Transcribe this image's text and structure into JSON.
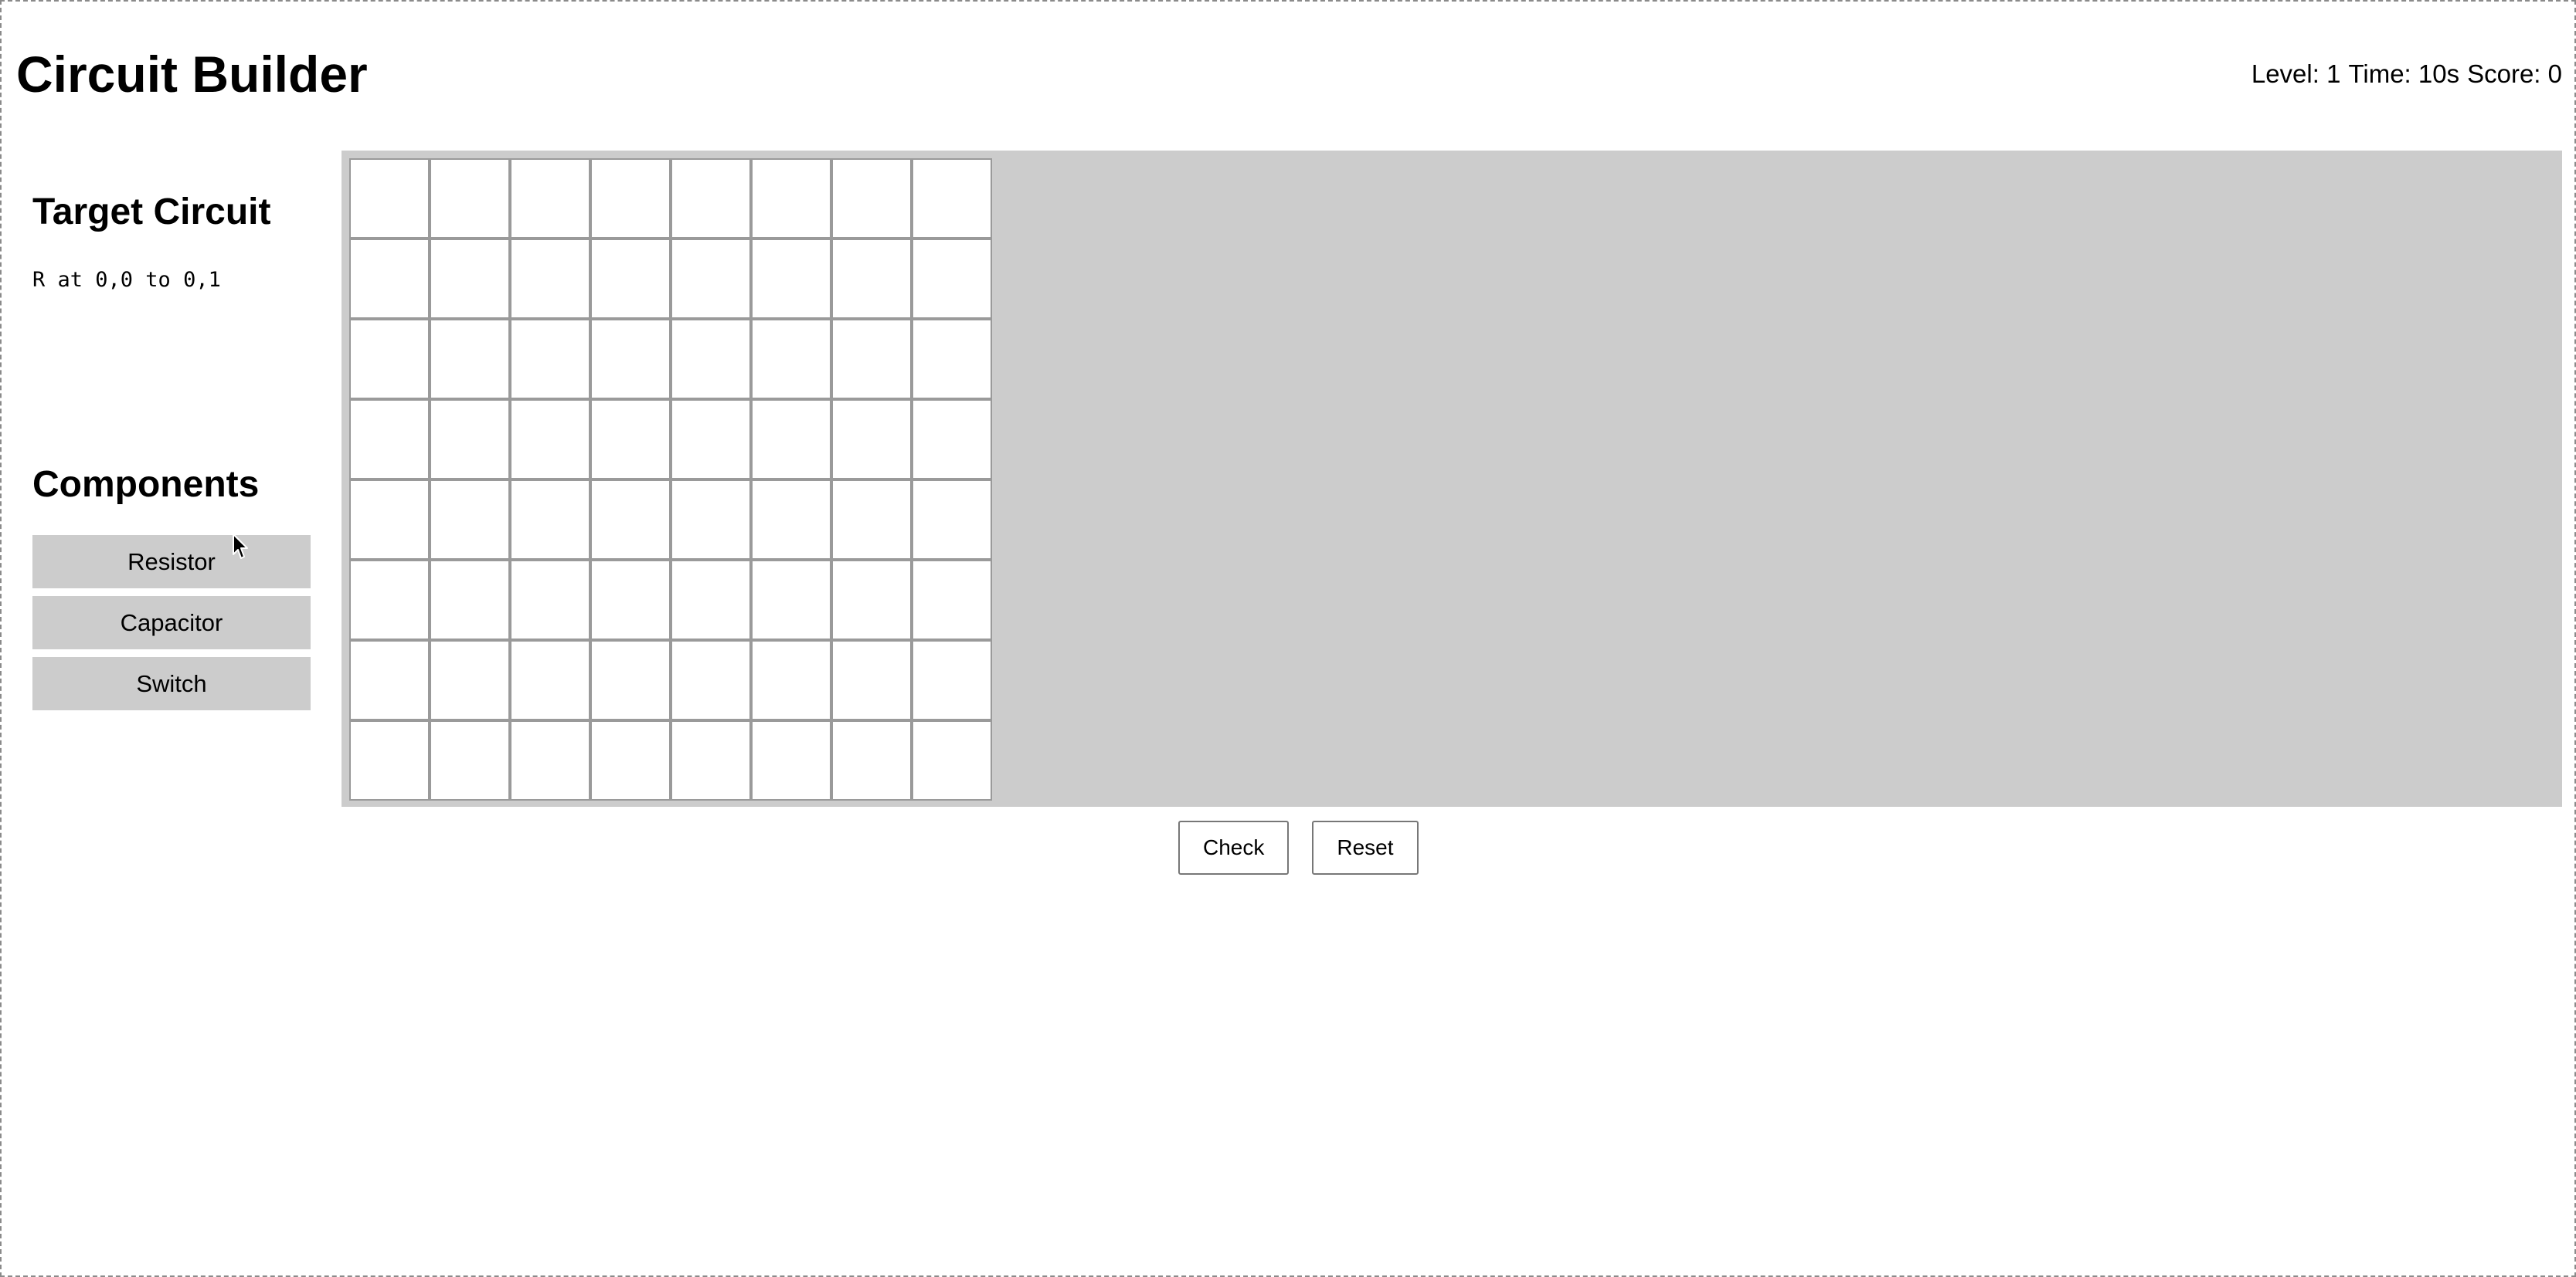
{
  "header": {
    "title": "Circuit Builder",
    "level": "Level: 1",
    "time": "Time: 10s",
    "score": "Score: 0"
  },
  "sidebar": {
    "target_title": "Target Circuit",
    "target_text": "R at 0,0 to 0,1",
    "components_title": "Components",
    "components": [
      {
        "label": "Resistor"
      },
      {
        "label": "Capacitor"
      },
      {
        "label": "Switch"
      }
    ]
  },
  "board": {
    "rows": 8,
    "cols": 8
  },
  "actions": {
    "check_label": "Check",
    "reset_label": "Reset"
  },
  "colors": {
    "board_background": "#cccccc",
    "cell_background": "#ffffff",
    "cell_border": "#9a9a9a",
    "component_button": "#cccccc"
  },
  "icons": {
    "cursor": "mouse-pointer-icon"
  }
}
